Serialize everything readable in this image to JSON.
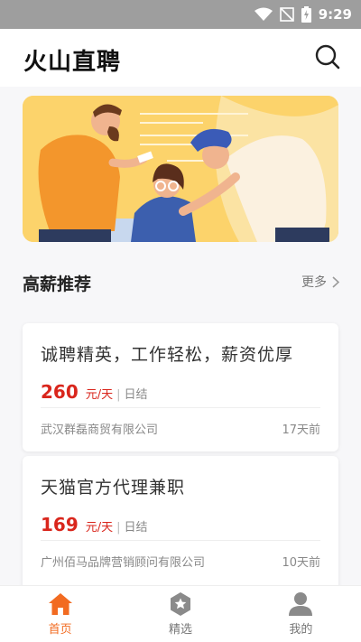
{
  "status_bar": {
    "time": "9:29"
  },
  "app": {
    "title": "火山直聘"
  },
  "section": {
    "title": "高薪推荐",
    "more_label": "更多"
  },
  "jobs": [
    {
      "title": "诚聘精英，工作轻松，薪资优厚",
      "salary": "260",
      "unit": "元/天",
      "settlement": "日结",
      "company": "武汉群磊商贸有限公司",
      "posted": "17天前"
    },
    {
      "title": "天猫官方代理兼职",
      "salary": "169",
      "unit": "元/天",
      "settlement": "日结",
      "company": "广州佰马品牌营销顾问有限公司",
      "posted": "10天前"
    }
  ],
  "bottom_nav": [
    {
      "label": "首页",
      "icon": "home-icon",
      "active": true
    },
    {
      "label": "精选",
      "icon": "star-badge-icon",
      "active": false
    },
    {
      "label": "我的",
      "icon": "person-icon",
      "active": false
    }
  ],
  "colors": {
    "accent": "#f26b21",
    "salary": "#d9261c",
    "banner": "#fcd36b"
  }
}
